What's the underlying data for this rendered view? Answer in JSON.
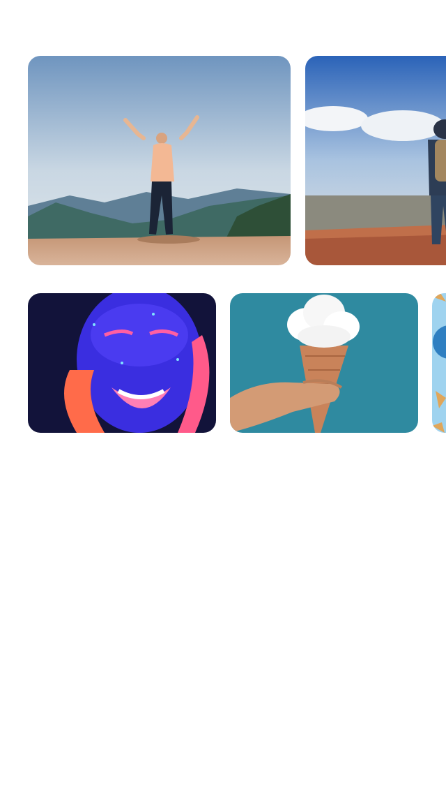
{
  "carousels": {
    "featured": {
      "items": [
        {
          "subject": "person-arms-raised-mountain-icon"
        },
        {
          "subject": "hiker-with-backpack-cliff-icon"
        }
      ]
    },
    "recent": {
      "items": [
        {
          "subject": "neon-paint-face-icon"
        },
        {
          "subject": "cloud-ice-cream-cone-icon"
        },
        {
          "subject": "umbrellas-sky-icon"
        }
      ]
    }
  },
  "colors": {
    "background": "#ffffff",
    "sky_blue": "#8fb6d8",
    "teal": "#2e7d8f",
    "neon_purple": "#3b2bd6",
    "neon_pink": "#ff4fa3"
  }
}
